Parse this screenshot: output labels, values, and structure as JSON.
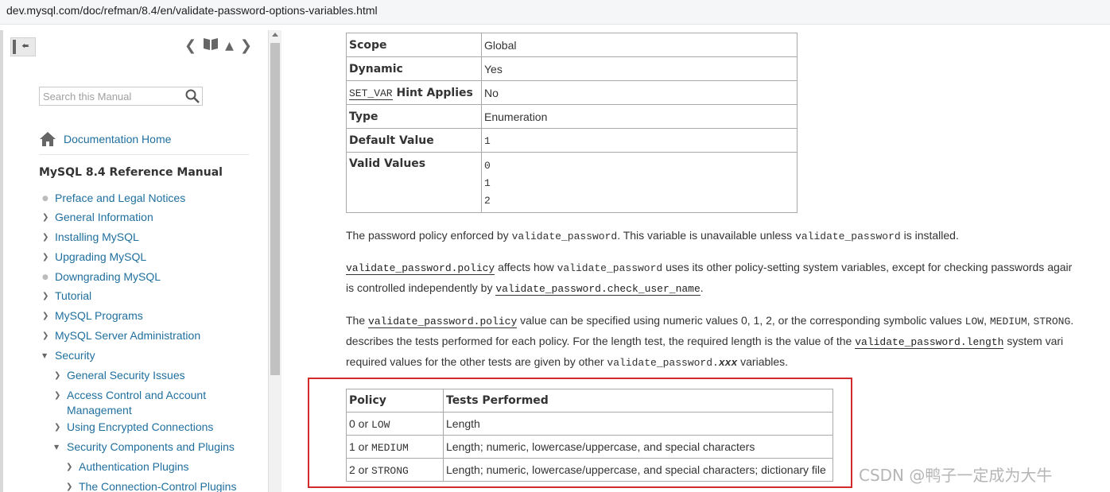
{
  "browser": {
    "url": "dev.mysql.com/doc/refman/8.4/en/validate-password-options-variables.html"
  },
  "sidebar": {
    "search_placeholder": "Search this Manual",
    "doc_home": "Documentation Home",
    "manual_title": "MySQL 8.4 Reference Manual",
    "toc": [
      {
        "label": "Preface and Legal Notices",
        "marker": "dot",
        "level": 0
      },
      {
        "label": "General Information",
        "marker": "arrow",
        "level": 0
      },
      {
        "label": "Installing MySQL",
        "marker": "arrow",
        "level": 0
      },
      {
        "label": "Upgrading MySQL",
        "marker": "arrow",
        "level": 0
      },
      {
        "label": "Downgrading MySQL",
        "marker": "dot",
        "level": 0
      },
      {
        "label": "Tutorial",
        "marker": "arrow",
        "level": 0
      },
      {
        "label": "MySQL Programs",
        "marker": "arrow",
        "level": 0
      },
      {
        "label": "MySQL Server Administration",
        "marker": "arrow",
        "level": 0
      },
      {
        "label": "Security",
        "marker": "open",
        "level": 0
      },
      {
        "label": "General Security Issues",
        "marker": "arrow",
        "level": 1
      },
      {
        "label": "Access Control and Account Management",
        "marker": "arrow",
        "level": 1
      },
      {
        "label": "Using Encrypted Connections",
        "marker": "arrow",
        "level": 1
      },
      {
        "label": "Security Components and Plugins",
        "marker": "open",
        "level": 1
      },
      {
        "label": "Authentication Plugins",
        "marker": "arrow",
        "level": 2
      },
      {
        "label": "The Connection-Control Plugins",
        "marker": "arrow",
        "level": 2
      }
    ]
  },
  "props_table": {
    "rows": [
      {
        "key": "Scope",
        "value": "Global"
      },
      {
        "key_code": "SET_VAR",
        "key_suffix": " Hint Applies",
        "value": "No"
      },
      {
        "key": "Dynamic",
        "value": "Yes"
      },
      {
        "key": "Type",
        "value": "Enumeration"
      },
      {
        "key": "Default Value",
        "value": "1"
      }
    ],
    "valid_values_key": "Valid Values",
    "valid_values": [
      "0",
      "1",
      "2"
    ]
  },
  "para1": {
    "t1": "The password policy enforced by ",
    "c1": "validate_password",
    "t2": ". This variable is unavailable unless ",
    "c2": "validate_password",
    "t3": " is installed."
  },
  "para2": {
    "c1": "validate_password.policy",
    "t1": " affects how ",
    "c2": "validate_password",
    "t2": " uses its other policy-setting system variables, except for checking passwords agair",
    "t3": "is controlled independently by ",
    "c3": "validate_password.check_user_name",
    "t4": "."
  },
  "para3": {
    "t1": "The ",
    "c1": "validate_password.policy",
    "t2": " value can be specified using numeric values 0, 1, 2, or the corresponding symbolic values ",
    "c2": "LOW",
    "t3": ", ",
    "c3": "MEDIUM",
    "t4": ", ",
    "c4": "STRONG",
    "t5": ".",
    "t6": "describes the tests performed for each policy. For the length test, the required length is the value of the ",
    "c5": "validate_password.length",
    "t7": " system vari",
    "t8": "required values for the other tests are given by other ",
    "c6": "validate_password.",
    "c6i": "xxx",
    "t9": " variables."
  },
  "policy_table": {
    "headers": [
      "Policy",
      "Tests Performed"
    ],
    "rows": [
      {
        "num": "0 or ",
        "sym": "LOW",
        "tests": "Length"
      },
      {
        "num": "1 or ",
        "sym": "MEDIUM",
        "tests": "Length; numeric, lowercase/uppercase, and special characters"
      },
      {
        "num": "2 or ",
        "sym": "STRONG",
        "tests": "Length; numeric, lowercase/uppercase, and special characters; dictionary file"
      }
    ]
  },
  "watermark": "CSDN @鸭子一定成为大牛"
}
